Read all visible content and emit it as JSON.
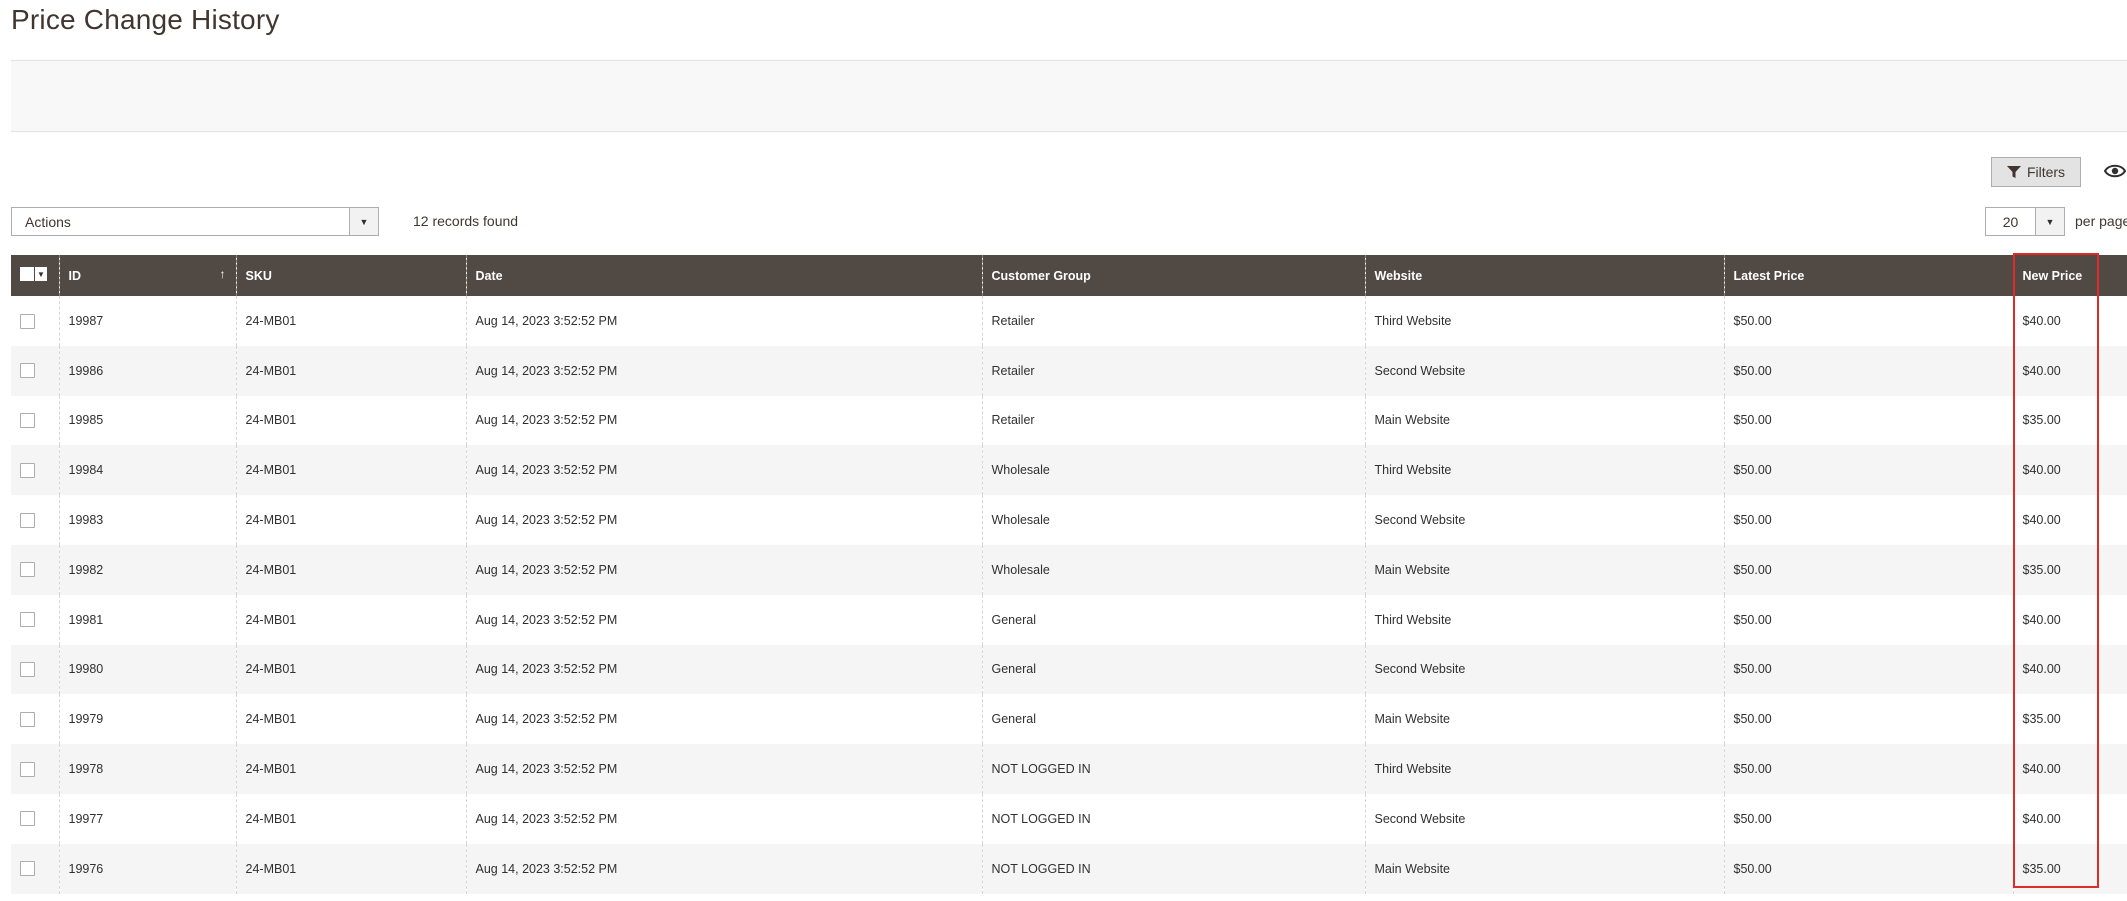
{
  "page": {
    "title": "Price Change History"
  },
  "toolbar": {
    "filters_label": "Filters",
    "actions_label": "Actions",
    "records_found": "12 records found",
    "per_page_value": "20",
    "per_page_label": "per page"
  },
  "grid": {
    "columns": [
      "ID",
      "SKU",
      "Date",
      "Customer Group",
      "Website",
      "Latest Price",
      "New Price"
    ],
    "sort": {
      "column": "ID",
      "indicator": "↑"
    },
    "rows": [
      [
        "19987",
        "24-MB01",
        "Aug 14, 2023 3:52:52 PM",
        "Retailer",
        "Third Website",
        "$50.00",
        "$40.00"
      ],
      [
        "19986",
        "24-MB01",
        "Aug 14, 2023 3:52:52 PM",
        "Retailer",
        "Second Website",
        "$50.00",
        "$40.00"
      ],
      [
        "19985",
        "24-MB01",
        "Aug 14, 2023 3:52:52 PM",
        "Retailer",
        "Main Website",
        "$50.00",
        "$35.00"
      ],
      [
        "19984",
        "24-MB01",
        "Aug 14, 2023 3:52:52 PM",
        "Wholesale",
        "Third Website",
        "$50.00",
        "$40.00"
      ],
      [
        "19983",
        "24-MB01",
        "Aug 14, 2023 3:52:52 PM",
        "Wholesale",
        "Second Website",
        "$50.00",
        "$40.00"
      ],
      [
        "19982",
        "24-MB01",
        "Aug 14, 2023 3:52:52 PM",
        "Wholesale",
        "Main Website",
        "$50.00",
        "$35.00"
      ],
      [
        "19981",
        "24-MB01",
        "Aug 14, 2023 3:52:52 PM",
        "General",
        "Third Website",
        "$50.00",
        "$40.00"
      ],
      [
        "19980",
        "24-MB01",
        "Aug 14, 2023 3:52:52 PM",
        "General",
        "Second Website",
        "$50.00",
        "$40.00"
      ],
      [
        "19979",
        "24-MB01",
        "Aug 14, 2023 3:52:52 PM",
        "General",
        "Main Website",
        "$50.00",
        "$35.00"
      ],
      [
        "19978",
        "24-MB01",
        "Aug 14, 2023 3:52:52 PM",
        "NOT LOGGED IN",
        "Third Website",
        "$50.00",
        "$40.00"
      ],
      [
        "19977",
        "24-MB01",
        "Aug 14, 2023 3:52:52 PM",
        "NOT LOGGED IN",
        "Second Website",
        "$50.00",
        "$40.00"
      ],
      [
        "19976",
        "24-MB01",
        "Aug 14, 2023 3:52:52 PM",
        "NOT LOGGED IN",
        "Main Website",
        "$50.00",
        "$35.00"
      ]
    ]
  },
  "icons": {
    "filters": "funnel-icon",
    "columns": "eye-icon",
    "dropdown": "chevron-down-icon"
  },
  "colors": {
    "header_bg": "#514943",
    "highlight": "#e02b27",
    "title": "#41362f"
  }
}
